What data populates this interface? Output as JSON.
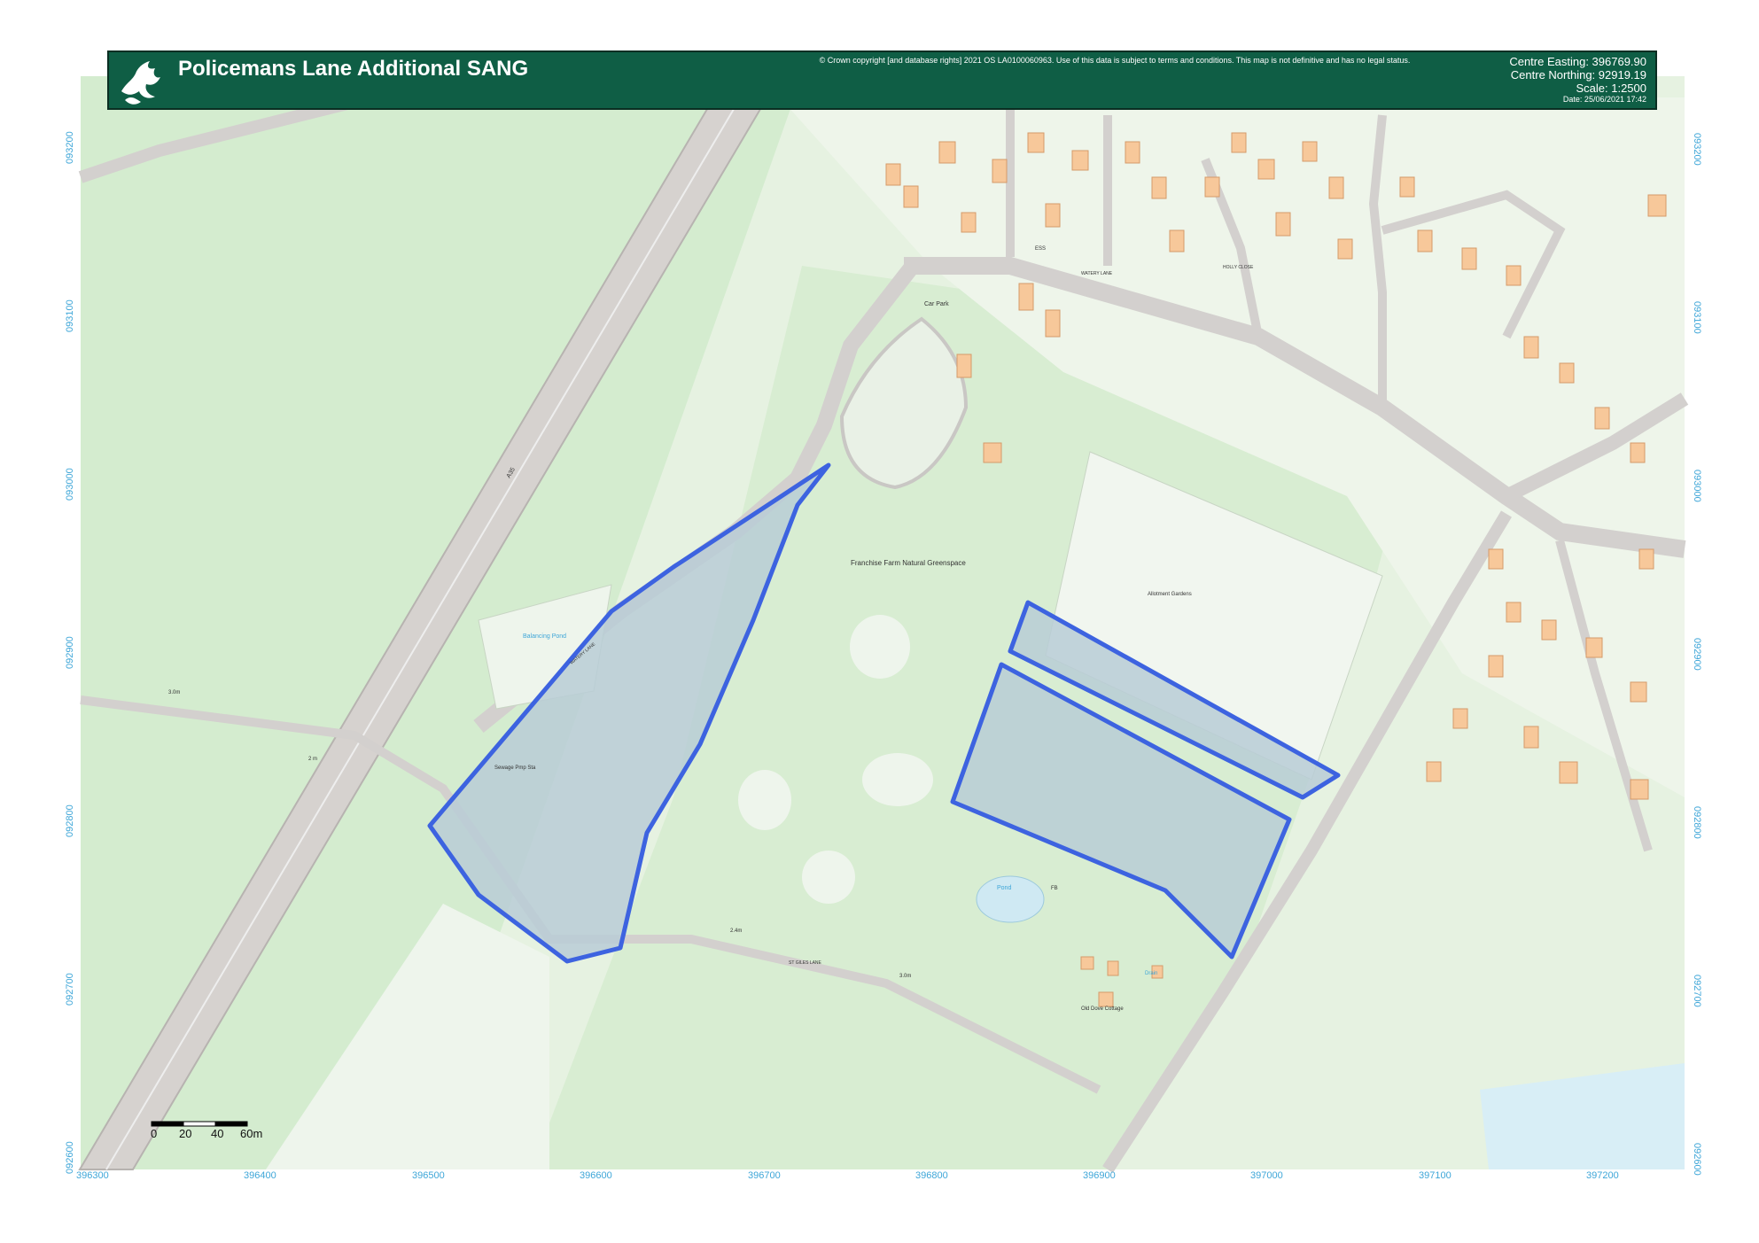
{
  "header": {
    "title": "Policemans Lane Additional SANG",
    "copyright": "© Crown copyright [and database rights] 2021 OS LA0100060963. Use of this data is subject to terms and conditions. This map is not definitive and has no legal status.",
    "centre_easting": "Centre Easting: 396769.90",
    "centre_northing": "Centre Northing: 92919.19",
    "scale": "Scale: 1:2500",
    "date": "Date: 25/06/2021 17:42",
    "logo_icon": "dragon-emblem-icon"
  },
  "grid": {
    "eastings": [
      "396300",
      "396400",
      "396500",
      "396600",
      "396700",
      "396800",
      "396900",
      "397000",
      "397100",
      "397200"
    ],
    "northings": [
      "093200",
      "093100",
      "093000",
      "092900",
      "092800",
      "092700",
      "092600"
    ]
  },
  "labels": {
    "road_a35": "A35",
    "car_park": "Car Park",
    "natural_greenspace": "Franchise Farm Natural Greenspace",
    "allotment_gardens": "Allotment Gardens",
    "balancing_pond": "Balancing Pond",
    "sewage_pump_sta": "Sewage Pmp Sta",
    "pond": "Pond",
    "fb": "FB",
    "drain": "Drain",
    "old_cottage": "Old Dove Cottage",
    "width_3m": "3.0m",
    "width_2m": "2 m",
    "width_2_4m": "2.4m",
    "width_3_0m": "3.0m",
    "lane_name": "ST GILES LANE",
    "watery_lane": "WATERY LANE",
    "holly_close": "HOLLY CLOSE",
    "ess": "ESS"
  },
  "scalebar": {
    "ticks": [
      "0",
      "20",
      "40",
      "60m"
    ]
  },
  "colors": {
    "sang_outline": "#3d63e0",
    "sang_fill": "#b9ccd6",
    "field": "#d9edd5",
    "road": "#d3d0ce",
    "building": "#f7c89a",
    "header_bg": "#0f5e45",
    "grid_label": "#3ea6d8",
    "water": "#cfe9f3"
  }
}
